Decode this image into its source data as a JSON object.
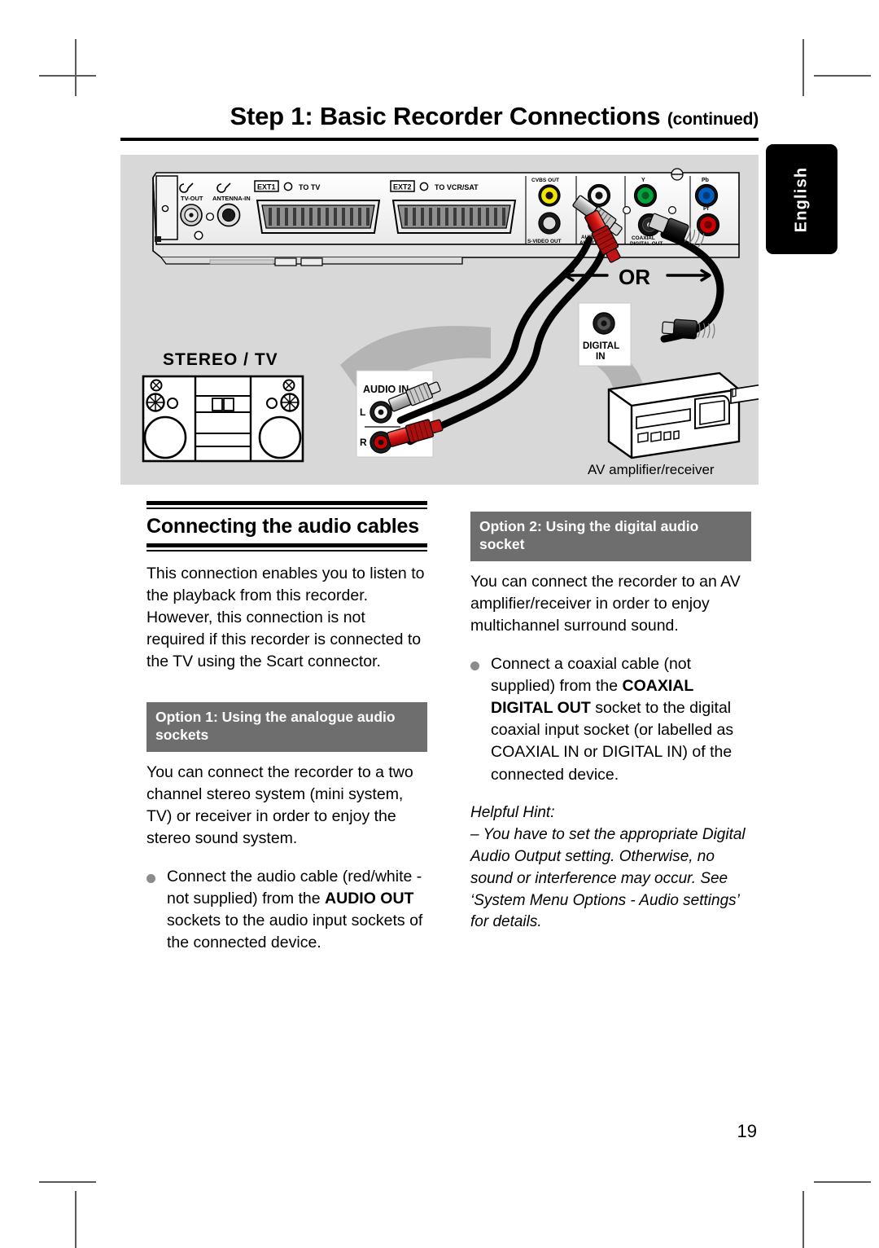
{
  "page": {
    "title_main": "Step 1: Basic Recorder Connections",
    "title_suffix": "(continued)",
    "side_tab": "English",
    "page_number": "19"
  },
  "diagram": {
    "rear_panel_labels": {
      "tv_out": "TV-OUT",
      "antenna_in": "ANTENNA-IN",
      "ext1": "EXT1",
      "to_tv": "TO TV",
      "ext2": "EXT2",
      "to_vcr_sat": "TO VCR/SAT",
      "cvbs_out": "CVBS OUT",
      "s_video_out": "S-VIDEO OUT",
      "audio_out": "AUDIO OUT",
      "coaxial_digital_out": "COAXIAL DIGITAL OUT",
      "y": "Y",
      "pb": "Pb",
      "pr": "Pr"
    },
    "stereo_label": "STEREO / TV",
    "audio_in_label": "AUDIO IN",
    "audio_in_left": "L",
    "audio_in_right": "R",
    "or_label": "OR",
    "digital_in_label_1": "DIGITAL",
    "digital_in_label_2": "IN",
    "amplifier_caption": "AV amplifier/receiver"
  },
  "left_column": {
    "section_title": "Connecting the audio cables",
    "intro": "This connection enables you to listen to the playback from this recorder. However, this connection is not required if this recorder is connected to the TV using the Scart connector.",
    "option_bar": "Option 1: Using the analogue audio sockets",
    "option_body": "You can connect the recorder to a two channel stereo system (mini system, TV) or receiver in order to enjoy the stereo sound system.",
    "bullet_pre": "Connect the audio cable (red/white - not supplied) from the ",
    "bullet_bold": "AUDIO OUT",
    "bullet_post": " sockets to the audio input sockets of the connected device."
  },
  "right_column": {
    "option_bar": "Option 2: Using the digital audio socket",
    "option_body": "You can connect the recorder to an AV amplifier/receiver in order to enjoy multichannel surround sound.",
    "bullet_pre": "Connect a coaxial cable (not supplied) from the ",
    "bullet_bold": "COAXIAL DIGITAL OUT",
    "bullet_post": " socket to the digital coaxial input socket (or labelled as COAXIAL IN or DIGITAL IN) of the connected device.",
    "hint_title": "Helpful Hint:",
    "hint_body": "– You have to set the appropriate Digital Audio Output setting. Otherwise, no sound or interference may occur. See ‘System Menu Options - Audio settings’ for details."
  },
  "colors": {
    "panel_bg": "#d8d8d8",
    "option_bar": "#6e6e6e",
    "accent_red": "#cc0000",
    "accent_yellow": "#f2e300",
    "accent_green": "#00a63c",
    "accent_blue": "#0060c0",
    "tab_black": "#000000"
  }
}
